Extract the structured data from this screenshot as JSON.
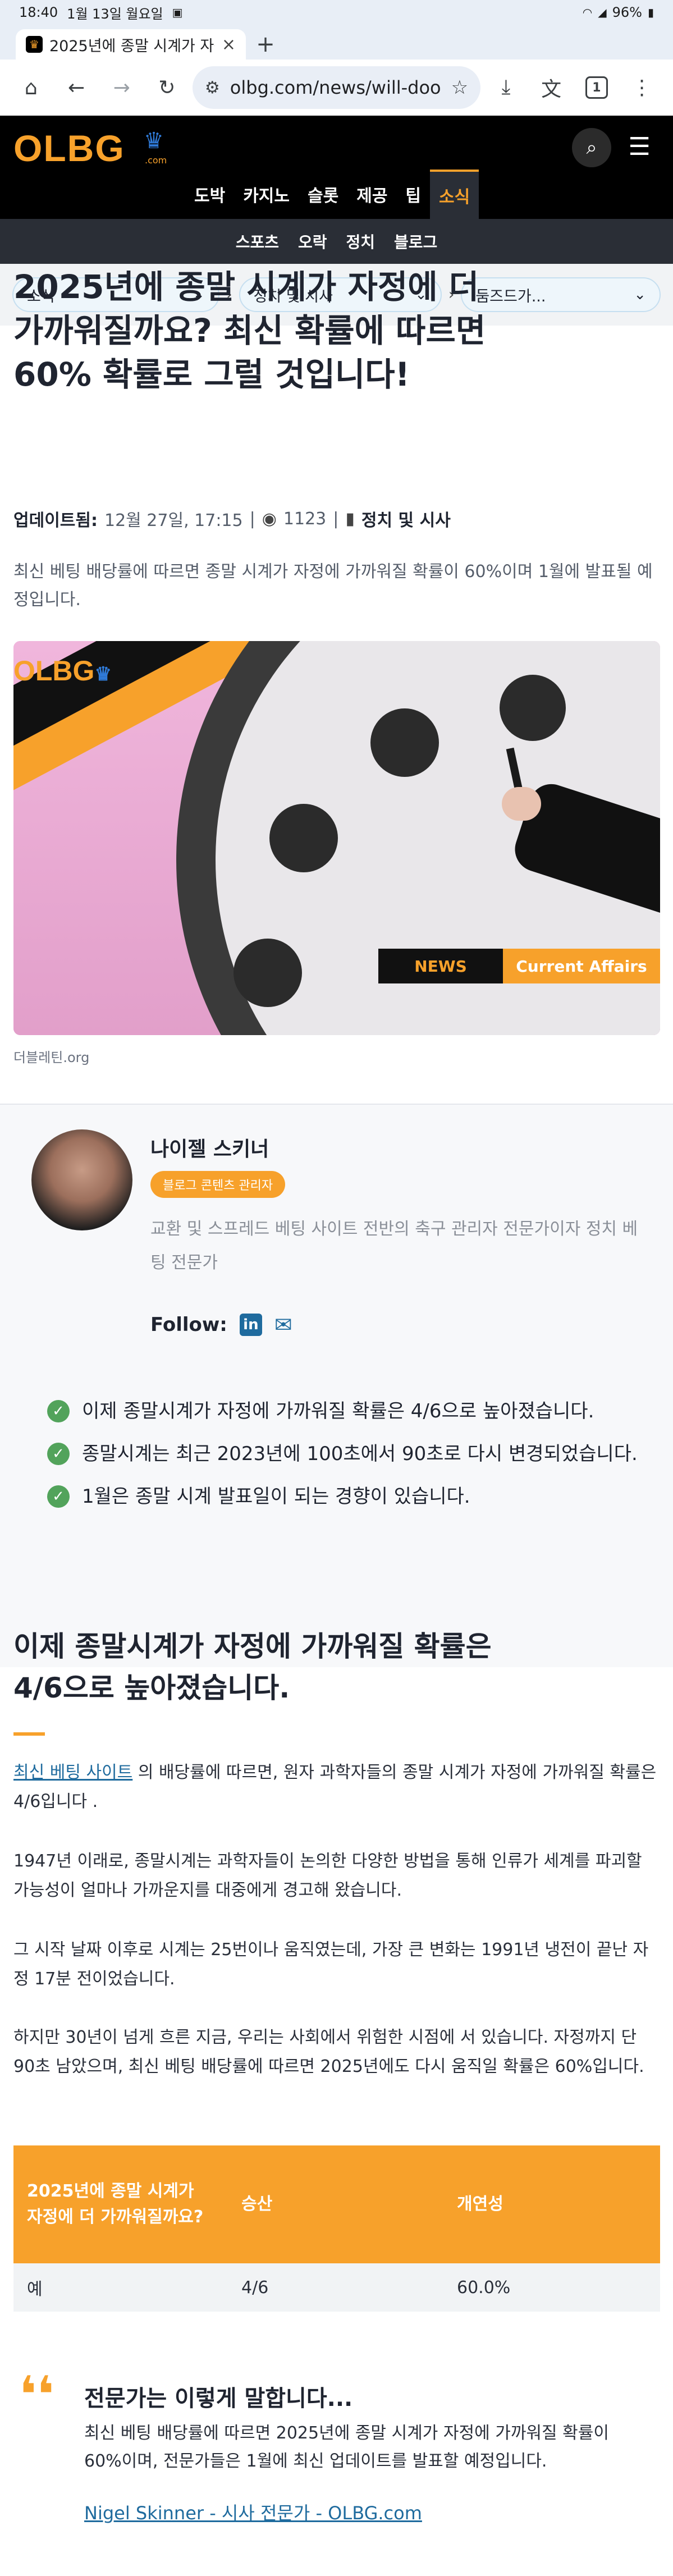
{
  "status_bar": {
    "time": "18:40",
    "date": "1월 13일 월요일",
    "battery": "96%"
  },
  "browser": {
    "tab_title": "2025년에 종말 시계가 자정에",
    "url": "olbg.com/news/will-doo",
    "tab_count": "1"
  },
  "site": {
    "logo": "OLBG",
    "logo_suffix": ".com",
    "main_nav": [
      "도박",
      "카지노",
      "슬롯",
      "제공",
      "팁",
      "소식"
    ],
    "sub_nav": [
      "스포츠",
      "오락",
      "정치",
      "블로그"
    ],
    "breadcrumbs": [
      "소식",
      "정치 및 시사",
      "둠즈드가..."
    ]
  },
  "article": {
    "headline": "2025년에 종말 시계가 자정에 더 가까워질까요? 최신 확률에 따르면 60% 확률로 그럴 것입니다!",
    "updated_label": "업데이트됨:",
    "updated_value": "12월 27일, 17:15",
    "views": "1123",
    "category": "정치 및 시사",
    "lead": "최신 베팅 배당률에 따르면 종말 시계가 자정에 가까워질 확률이 60%이며 1월에 발표될 예정입니다.",
    "hero_badge_news": "NEWS",
    "hero_badge_section": "Current Affairs",
    "hero_logo": "OLBG",
    "image_caption": "더블레틴.org"
  },
  "author": {
    "name": "나이젤 스키너",
    "badge": "블로그 콘텐츠 관리자",
    "bio": "교환 및 스프레드 베팅 사이트 전반의 축구 관리자 전문가이자 정치 베팅 전문가",
    "follow_label": "Follow:"
  },
  "takeaways": [
    "이제 종말시계가 자정에 가까워질 확률은 4/6으로 높아졌습니다.",
    "종말시계는 최근 2023년에 100초에서 90초로 다시 변경되었습니다.",
    "1월은 종말 시계 발표일이 되는 경향이 있습니다."
  ],
  "section": {
    "title": "이제 종말시계가 자정에 가까워질 확률은 4/6으로 높아졌습니다.",
    "p1_link": "최신 베팅 사이트",
    "p1_rest": " 의 배당률에 따르면, 원자 과학자들의 종말 시계가 자정에 가까워질 확률은 4/6입니다 .",
    "p2": "1947년 이래로, 종말시계는 과학자들이 논의한 다양한 방법을 통해 인류가 세계를 파괴할 가능성이 얼마나 가까운지를 대중에게 경고해 왔습니다.",
    "p3": "그 시작 날짜 이후로 시계는 25번이나 움직였는데, 가장 큰 변화는 1991년 냉전이 끝난 자정 17분 전이었습니다.",
    "p4": "하지만 30년이 넘게 흐른 지금, 우리는 사회에서 위험한 시점에 서 있습니다. 자정까지 단 90초 남았으며, 최신 베팅 배당률에 따르면 2025년에도 다시 움직일 확률은 60%입니다."
  },
  "table": {
    "headers": [
      "2025년에 종말 시계가 자정에 더 가까워질까요?",
      "승산",
      "개연성"
    ],
    "rows": [
      [
        "예",
        "4/6",
        "60.0%"
      ]
    ]
  },
  "quote": {
    "title": "전문가는 이렇게 말합니다...",
    "text": "최신 베팅 배당률에 따르면 2025년에 종말 시계가 자정에 가까워질 확률이 60%이며, 전문가들은 1월에 최신 업데이트를 발표할 예정입니다.",
    "link": "Nigel Skinner - 시사 전문가 - OLBG.com"
  },
  "colors": {
    "brand_orange": "#f7a12b",
    "header_black": "#000000",
    "subnav": "#2a2e36",
    "link_blue": "#1f6b9e",
    "check_green": "#52a35b"
  }
}
